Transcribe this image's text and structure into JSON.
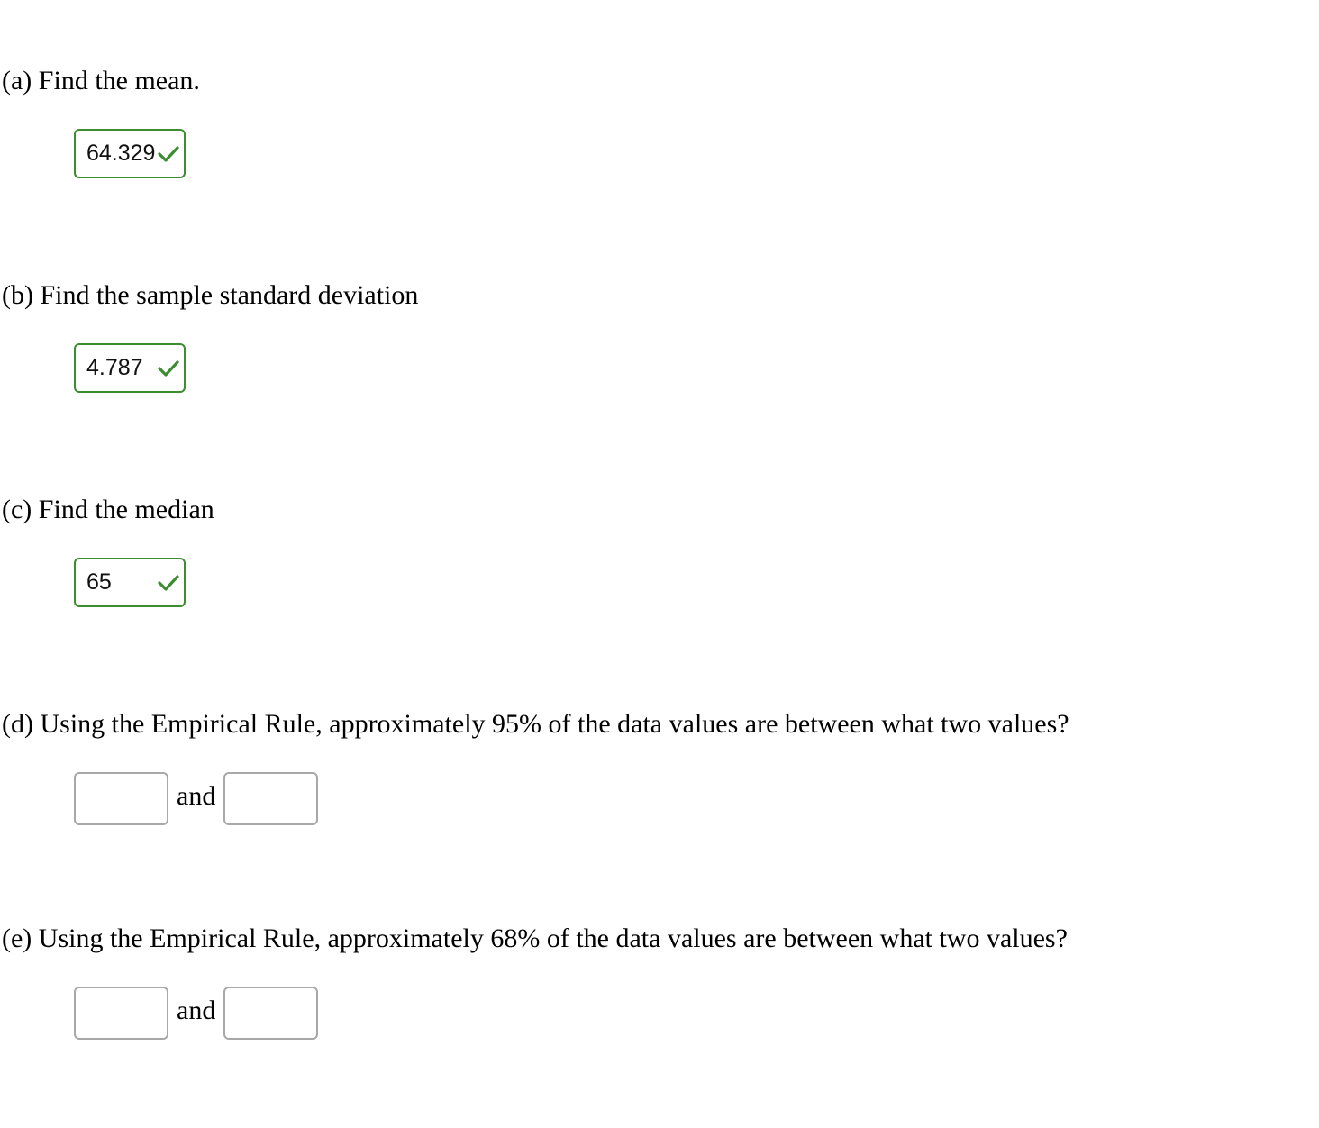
{
  "questions": {
    "a": {
      "prompt": "(a) Find the mean.",
      "answer": "64.329",
      "status": "correct"
    },
    "b": {
      "prompt": "(b) Find the sample standard deviation",
      "answer": "4.787",
      "status": "correct"
    },
    "c": {
      "prompt": "(c) Find the median",
      "answer": "65",
      "status": "correct"
    },
    "d": {
      "prompt": "(d) Using the Empirical Rule, approximately 95% of the data values are between what two values?",
      "lower": "",
      "upper": "",
      "connector": "and"
    },
    "e": {
      "prompt": "(e) Using the Empirical Rule, approximately 68% of the data values are between what two values?",
      "lower": "",
      "upper": "",
      "connector": "and"
    }
  },
  "colors": {
    "correct": "#3c8d2f",
    "empty_border": "#a8a8a8"
  },
  "icons": {
    "correct": "checkmark-icon"
  }
}
